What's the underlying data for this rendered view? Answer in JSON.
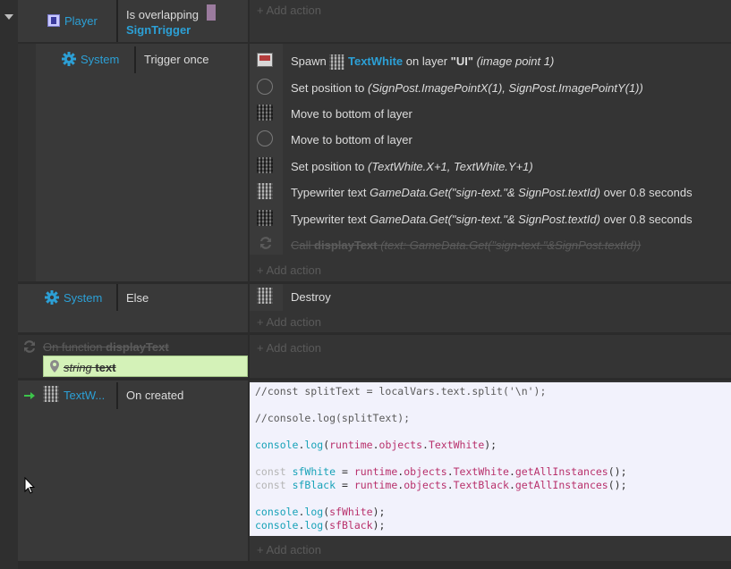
{
  "colors": {
    "object_name": "#2ca0d6",
    "condition_bg": "#393939",
    "action_bg": "#343434",
    "code_bg": "#f2f2fc",
    "param_bg": "#d4f2b8"
  },
  "add_action_label": "Add action",
  "block1": {
    "object": "Player",
    "condition": "Is overlapping",
    "condition_target": "SignTrigger"
  },
  "block2": {
    "object": "System",
    "condition": "Trigger once",
    "actions": [
      {
        "verb": "Spawn",
        "object": "TextWhite",
        "mid": "on layer",
        "layer": "\"UI\"",
        "suffix": "(image point 1)"
      },
      {
        "verb": "Set position to",
        "params": "(SignPost.ImagePointX(1), SignPost.ImagePointY(1))"
      },
      {
        "verb": "Move to bottom of layer"
      },
      {
        "verb": "Move to bottom of layer"
      },
      {
        "verb": "Set position to",
        "params": "(TextWhite.X+1, TextWhite.Y+1)"
      },
      {
        "verb": "Typewriter text",
        "params": "GameData.Get(\"sign-text.\"& SignPost.textId)",
        "suffix": "over 0.8 seconds"
      },
      {
        "verb": "Typewriter text",
        "params": "GameData.Get(\"sign-text.\"& SignPost.textId)",
        "suffix": "over 0.8 seconds"
      },
      {
        "verb": "Call",
        "func": "displayText",
        "params": "(text: GameData.Get(\"sign-text.\"&SignPost.textId))"
      }
    ]
  },
  "block3": {
    "object": "System",
    "condition": "Else",
    "action": "Destroy"
  },
  "function_block": {
    "label": "On function",
    "name": "displayText",
    "param_type": "string",
    "param_name": "text"
  },
  "block4": {
    "object": "TextW...",
    "condition": "On created"
  },
  "code": {
    "l1": "//const splitText = localVars.text.split('\\n');",
    "l2": "//console.log(splitText);",
    "l3_a": "console",
    "l3_b": ".",
    "l3_c": "log",
    "l3_d": "(",
    "l3_e": "runtime",
    "l3_f": ".",
    "l3_g": "objects",
    "l3_h": ".",
    "l3_i": "TextWhite",
    "l3_j": ");",
    "l4_kw": "const",
    "l4_v": "sfWhite",
    "l4_eq": " = ",
    "l4_a": "runtime",
    "l4_b": ".",
    "l4_c": "objects",
    "l4_d": ".",
    "l4_e": "TextWhite",
    "l4_f": ".",
    "l4_g": "getAllInstances",
    "l4_h": "();",
    "l5_kw": "const",
    "l5_v": "sfBlack",
    "l5_eq": " = ",
    "l5_a": "runtime",
    "l5_b": ".",
    "l5_c": "objects",
    "l5_d": ".",
    "l5_e": "TextBlack",
    "l5_f": ".",
    "l5_g": "getAllInstances",
    "l5_h": "();",
    "l6_a": "console",
    "l6_b": ".",
    "l6_c": "log",
    "l6_d": "(",
    "l6_e": "sfWhite",
    "l6_f": ");",
    "l7_a": "console",
    "l7_b": ".",
    "l7_c": "log",
    "l7_d": "(",
    "l7_e": "sfBlack",
    "l7_f": ");"
  }
}
